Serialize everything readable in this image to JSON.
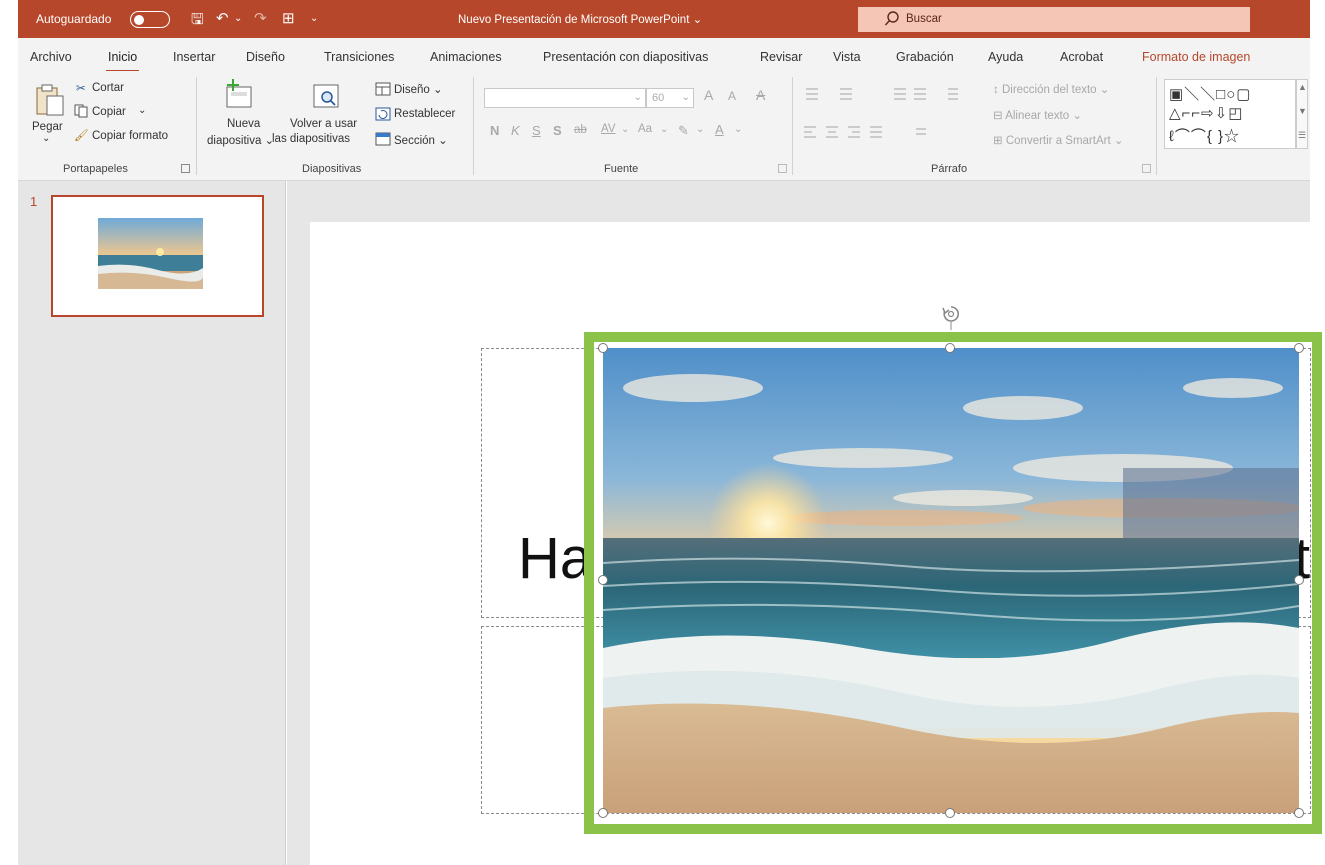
{
  "titlebar": {
    "autosave_label": "Autoguardado",
    "autosave_state": "off",
    "document_title": "Nuevo Presentación de Microsoft PowerPoint",
    "title_dropdown": "⌄",
    "search_placeholder": "Buscar",
    "qa_save": "🖫",
    "qa_undo": "↶",
    "qa_undo_dd": "⌄",
    "qa_redo": "↷",
    "qa_present": "⊞",
    "qa_customize": "⌄"
  },
  "tabs": [
    {
      "label": "Archivo"
    },
    {
      "label": "Inicio",
      "active": true
    },
    {
      "label": "Insertar"
    },
    {
      "label": "Diseño"
    },
    {
      "label": "Transiciones"
    },
    {
      "label": "Animaciones"
    },
    {
      "label": "Presentación con diapositivas"
    },
    {
      "label": "Revisar"
    },
    {
      "label": "Vista"
    },
    {
      "label": "Grabación"
    },
    {
      "label": "Ayuda"
    },
    {
      "label": "Acrobat"
    },
    {
      "label": "Formato de imagen",
      "contextual": true
    }
  ],
  "ribbon": {
    "clipboard": {
      "group_label": "Portapapeles",
      "paste": "Pegar",
      "paste_dd": "⌄",
      "cut": "Cortar",
      "copy": "Copiar",
      "copy_dd": "⌄",
      "format_painter": "Copiar formato"
    },
    "slides": {
      "group_label": "Diapositivas",
      "new_slide_line1": "Nueva",
      "new_slide_line2": "diapositiva ⌄",
      "reuse_line1": "Volver a usar",
      "reuse_line2": "las diapositivas",
      "layout": "Diseño ⌄",
      "reset": "Restablecer",
      "section": "Sección ⌄"
    },
    "font": {
      "group_label": "Fuente",
      "font_name": "",
      "font_size": "60",
      "grow": "A",
      "shrink": "A",
      "clear": "A",
      "bold": "N",
      "italic": "K",
      "underline": "S",
      "shadow": "S",
      "strike": "ab",
      "spacing": "AV",
      "case": "Aa",
      "highlight": "✎",
      "color": "A",
      "dd": "⌄"
    },
    "paragraph": {
      "group_label": "Párrafo",
      "text_direction": "Dirección del texto",
      "align_text": "Alinear texto",
      "smartart": "Convertir a SmartArt",
      "dd": "⌄"
    },
    "drawing": {
      "shape_row1": "▣＼＼□○▢",
      "shape_row2": "△⌐⌐⇨⇩◰",
      "shape_row3": "ℓ⌒⌒{ }☆"
    }
  },
  "slides_pane": {
    "slide_number": "1"
  },
  "slide": {
    "title_text": "Ha",
    "title_tail": "t"
  }
}
